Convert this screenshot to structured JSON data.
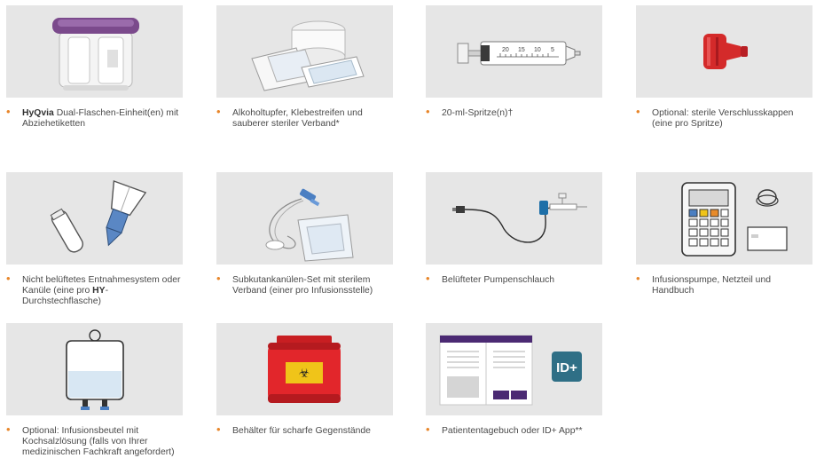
{
  "items": [
    {
      "bold": "HyQvia",
      "text": " Dual-Flaschen-Einheit(en) mit Abziehetiketten",
      "icon": "hyqvia-dual-vial-unit"
    },
    {
      "text": "Alkoholtupfer, Klebestreifen und sauberer steriler Verband*",
      "icon": "swabs-and-tape"
    },
    {
      "text": "20-ml-Spritze(n)†",
      "icon": "syringe",
      "syringe_marks": [
        "20",
        "15",
        "10",
        "5"
      ]
    },
    {
      "text": "Optional: sterile Verschlusskappen (eine pro Spritze)",
      "icon": "sterile-cap"
    },
    {
      "text": "Nicht belüftetes Entnahmesystem oder Kanüle (eine pro ",
      "bold": "HY",
      "text_after": "-Durchstechflasche)",
      "icon": "transfer-device"
    },
    {
      "text": "Subkutankanülen-Set mit sterilem Verband (einer pro Infusionsstelle)",
      "icon": "needle-set"
    },
    {
      "text": "Belüfteter Pumpenschlauch",
      "icon": "pump-tubing"
    },
    {
      "text": "Infusionspumpe, Netzteil und Handbuch",
      "icon": "infusion-pump"
    },
    {
      "text": "Optional: Infusionsbeutel mit Kochsalzlösung (falls von Ihrer medizinischen Fachkraft angefordert)",
      "icon": "saline-bag"
    },
    {
      "text": "Behälter für scharfe Gegenstände",
      "icon": "sharps-container"
    },
    {
      "text": "Patiententagebuch oder ID+ App**",
      "icon": "diary-and-app",
      "app_label": "ID+"
    }
  ],
  "colors": {
    "tile": "#e6e6e6",
    "bullet": "#e8862a",
    "hyqvia_purple": "#7b4a8c",
    "cap_red": "#d42a2a",
    "diary_purple": "#4b2a73",
    "app_teal": "#2f6f86"
  }
}
